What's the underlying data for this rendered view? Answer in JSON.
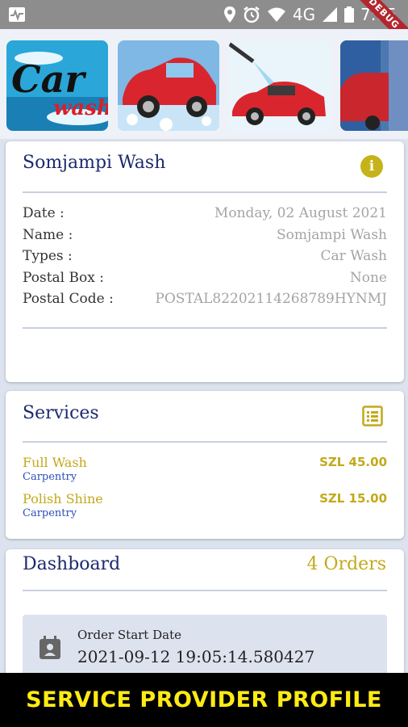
{
  "status_bar": {
    "network": "4G",
    "time": "7:05",
    "debug_label": "DEBUG",
    "icons": [
      "activity-icon",
      "location-icon",
      "alarm-icon",
      "wifi-icon",
      "signal-icon",
      "battery-icon"
    ]
  },
  "gallery": {
    "images": [
      "car-wash-logo-image",
      "car-foam-wash-image",
      "pressure-wash-image",
      "brush-wash-image"
    ],
    "logo_text": [
      "Car",
      "wash"
    ]
  },
  "profile": {
    "title": "Somjampi Wash",
    "rows": [
      {
        "label": "Date :",
        "value": "Monday, 02 August 2021"
      },
      {
        "label": "Name :",
        "value": "Somjampi Wash"
      },
      {
        "label": "Types :",
        "value": "Car Wash"
      },
      {
        "label": "Postal Box :",
        "value": "None"
      },
      {
        "label": "Postal Code :",
        "value": "POSTAL82202114268789HYNMJ"
      }
    ]
  },
  "services": {
    "title": "Services",
    "items": [
      {
        "name": "Full Wash",
        "category": "Carpentry",
        "price": "SZL 45.00"
      },
      {
        "name": "Polish Shine",
        "category": "Carpentry",
        "price": "SZL 15.00"
      }
    ]
  },
  "dashboard": {
    "title": "Dashboard",
    "orders_count": "4 Orders",
    "order": {
      "label": "Order Start Date",
      "value": "2021-09-12 19:05:14.580427"
    }
  },
  "banner": {
    "text": "SERVICE PROVIDER PROFILE"
  },
  "colors": {
    "accent_gold": "#c2a91a",
    "title_navy": "#1c2a6e",
    "category_blue": "#2f4fb8",
    "banner_text": "#ffeb14"
  }
}
